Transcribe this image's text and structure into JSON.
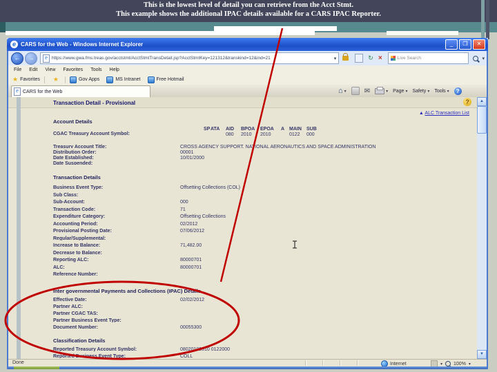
{
  "slide": {
    "title_line1": "This is the lowest level of detail you can retrieve from the Acct Stmt.",
    "title_line2": "This example shows the additional IPAC details available for a CARS IPAC Reporter."
  },
  "browser": {
    "window_title": "CARS for the Web - Windows Internet Explorer",
    "address_url": "https://www.gwa.fms.treas.gov/acctstmt/AcctStmtTransDetail.jsp?AcctStmtKey=121312&transkind=12&ind=21",
    "search_text": "Live Search",
    "menus": [
      "File",
      "Edit",
      "View",
      "Favorites",
      "Tools",
      "Help"
    ],
    "favorites_label": "Favorites",
    "favorites_links": [
      "Gov Apps",
      "MS Intranet",
      "Free Hotmail"
    ],
    "tab_title": "CARS for the Web",
    "command_buttons": [
      "Page",
      "Safety",
      "Tools"
    ],
    "status": {
      "done": "Done",
      "zone": "Internet",
      "zoom": "100%"
    }
  },
  "content": {
    "page_title": "Transaction Detail - Provisional",
    "top_link": "ALC Transaction List",
    "account": {
      "header": "Account Details",
      "tas_label": "CGAC Treasury Account Symbol:",
      "tas_columns": [
        {
          "label": "SP",
          "value": ""
        },
        {
          "label": "ATA",
          "value": ""
        },
        {
          "label": "AID",
          "value": "080"
        },
        {
          "label": "BPOA",
          "value": "2010"
        },
        {
          "label": "EPOA",
          "value": "2010"
        },
        {
          "label": "A",
          "value": ""
        },
        {
          "label": "MAIN",
          "value": "0122"
        },
        {
          "label": "SUB",
          "value": "000"
        }
      ],
      "rows": [
        {
          "label": "Treasury Account Title:",
          "value": "CROSS AGENCY SUPPORT, NATIONAL AERONAUTICS AND SPACE ADMINISTRATION"
        },
        {
          "label": "Distribution Order:",
          "value": "00001"
        },
        {
          "label": "Date Established:",
          "value": "10/01/2000"
        },
        {
          "label": "Date Suspended:",
          "value": ""
        }
      ]
    },
    "transaction": {
      "header": "Transaction Details",
      "rows": [
        {
          "label": "Business Event Type:",
          "value": "Offsetting Collections (COL)"
        },
        {
          "label": "Sub Class:",
          "value": ""
        },
        {
          "label": "Sub-Account:",
          "value": "000"
        },
        {
          "label": "Transaction Code:",
          "value": "71"
        },
        {
          "label": "Expenditure Category:",
          "value": "Offsetting Collections"
        },
        {
          "label": "Accounting Period:",
          "value": "02/2012"
        },
        {
          "label": "Provisional Posting Date:",
          "value": "07/06/2012"
        },
        {
          "label": "Regular/Supplemental:",
          "value": ""
        },
        {
          "label": "Increase to Balance:",
          "value": "71,482.00"
        },
        {
          "label": "Decrease to Balance:",
          "value": ""
        },
        {
          "label": "Reporting ALC:",
          "value": "80000701"
        },
        {
          "label": "ALC:",
          "value": "80000701"
        },
        {
          "label": "Reference Number:",
          "value": ""
        }
      ]
    },
    "ipac": {
      "header": "Inter governmental Payments and Collections (IPAC) Details",
      "rows": [
        {
          "label": "Effective Date:",
          "value": "02/02/2012"
        },
        {
          "label": "Partner ALC:",
          "value": ""
        },
        {
          "label": "Partner CGAC TAS:",
          "value": ""
        },
        {
          "label": "Partner Business Event Type:",
          "value": ""
        },
        {
          "label": "Document Number:",
          "value": "00055300"
        }
      ]
    },
    "classification": {
      "header": "Classification Details",
      "rows": [
        {
          "label": "Reported Treasury Account Symbol:",
          "value": "08020102010 0122000"
        },
        {
          "label": "Reported Business Event Type:",
          "value": "COLL"
        }
      ]
    }
  }
}
